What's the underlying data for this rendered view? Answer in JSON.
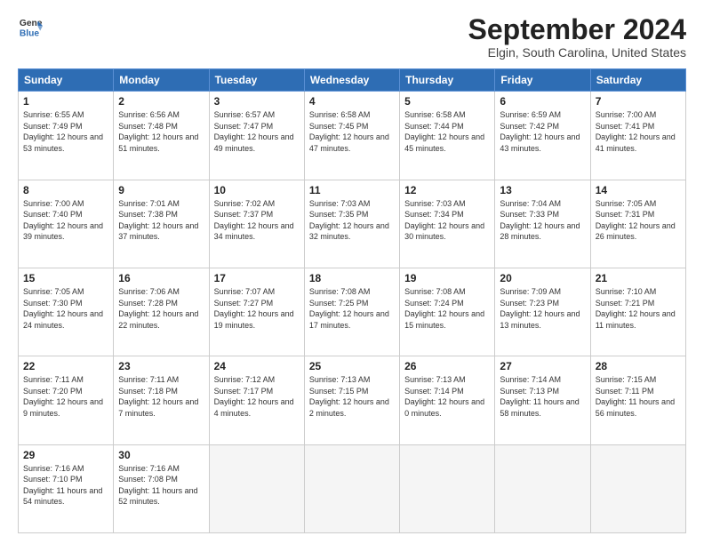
{
  "header": {
    "logo_line1": "General",
    "logo_line2": "Blue",
    "title": "September 2024",
    "location": "Elgin, South Carolina, United States"
  },
  "days": [
    "Sunday",
    "Monday",
    "Tuesday",
    "Wednesday",
    "Thursday",
    "Friday",
    "Saturday"
  ],
  "weeks": [
    [
      {
        "num": "1",
        "rise": "6:55 AM",
        "set": "7:49 PM",
        "daylight": "12 hours and 53 minutes."
      },
      {
        "num": "2",
        "rise": "6:56 AM",
        "set": "7:48 PM",
        "daylight": "12 hours and 51 minutes."
      },
      {
        "num": "3",
        "rise": "6:57 AM",
        "set": "7:47 PM",
        "daylight": "12 hours and 49 minutes."
      },
      {
        "num": "4",
        "rise": "6:58 AM",
        "set": "7:45 PM",
        "daylight": "12 hours and 47 minutes."
      },
      {
        "num": "5",
        "rise": "6:58 AM",
        "set": "7:44 PM",
        "daylight": "12 hours and 45 minutes."
      },
      {
        "num": "6",
        "rise": "6:59 AM",
        "set": "7:42 PM",
        "daylight": "12 hours and 43 minutes."
      },
      {
        "num": "7",
        "rise": "7:00 AM",
        "set": "7:41 PM",
        "daylight": "12 hours and 41 minutes."
      }
    ],
    [
      {
        "num": "8",
        "rise": "7:00 AM",
        "set": "7:40 PM",
        "daylight": "12 hours and 39 minutes."
      },
      {
        "num": "9",
        "rise": "7:01 AM",
        "set": "7:38 PM",
        "daylight": "12 hours and 37 minutes."
      },
      {
        "num": "10",
        "rise": "7:02 AM",
        "set": "7:37 PM",
        "daylight": "12 hours and 34 minutes."
      },
      {
        "num": "11",
        "rise": "7:03 AM",
        "set": "7:35 PM",
        "daylight": "12 hours and 32 minutes."
      },
      {
        "num": "12",
        "rise": "7:03 AM",
        "set": "7:34 PM",
        "daylight": "12 hours and 30 minutes."
      },
      {
        "num": "13",
        "rise": "7:04 AM",
        "set": "7:33 PM",
        "daylight": "12 hours and 28 minutes."
      },
      {
        "num": "14",
        "rise": "7:05 AM",
        "set": "7:31 PM",
        "daylight": "12 hours and 26 minutes."
      }
    ],
    [
      {
        "num": "15",
        "rise": "7:05 AM",
        "set": "7:30 PM",
        "daylight": "12 hours and 24 minutes."
      },
      {
        "num": "16",
        "rise": "7:06 AM",
        "set": "7:28 PM",
        "daylight": "12 hours and 22 minutes."
      },
      {
        "num": "17",
        "rise": "7:07 AM",
        "set": "7:27 PM",
        "daylight": "12 hours and 19 minutes."
      },
      {
        "num": "18",
        "rise": "7:08 AM",
        "set": "7:25 PM",
        "daylight": "12 hours and 17 minutes."
      },
      {
        "num": "19",
        "rise": "7:08 AM",
        "set": "7:24 PM",
        "daylight": "12 hours and 15 minutes."
      },
      {
        "num": "20",
        "rise": "7:09 AM",
        "set": "7:23 PM",
        "daylight": "12 hours and 13 minutes."
      },
      {
        "num": "21",
        "rise": "7:10 AM",
        "set": "7:21 PM",
        "daylight": "12 hours and 11 minutes."
      }
    ],
    [
      {
        "num": "22",
        "rise": "7:11 AM",
        "set": "7:20 PM",
        "daylight": "12 hours and 9 minutes."
      },
      {
        "num": "23",
        "rise": "7:11 AM",
        "set": "7:18 PM",
        "daylight": "12 hours and 7 minutes."
      },
      {
        "num": "24",
        "rise": "7:12 AM",
        "set": "7:17 PM",
        "daylight": "12 hours and 4 minutes."
      },
      {
        "num": "25",
        "rise": "7:13 AM",
        "set": "7:15 PM",
        "daylight": "12 hours and 2 minutes."
      },
      {
        "num": "26",
        "rise": "7:13 AM",
        "set": "7:14 PM",
        "daylight": "12 hours and 0 minutes."
      },
      {
        "num": "27",
        "rise": "7:14 AM",
        "set": "7:13 PM",
        "daylight": "11 hours and 58 minutes."
      },
      {
        "num": "28",
        "rise": "7:15 AM",
        "set": "7:11 PM",
        "daylight": "11 hours and 56 minutes."
      }
    ],
    [
      {
        "num": "29",
        "rise": "7:16 AM",
        "set": "7:10 PM",
        "daylight": "11 hours and 54 minutes."
      },
      {
        "num": "30",
        "rise": "7:16 AM",
        "set": "7:08 PM",
        "daylight": "11 hours and 52 minutes."
      },
      null,
      null,
      null,
      null,
      null
    ]
  ]
}
